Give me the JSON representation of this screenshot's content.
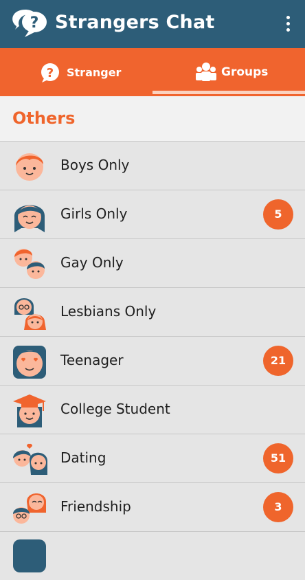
{
  "app": {
    "title": "Strangers Chat"
  },
  "tabs": [
    {
      "label": "Stranger",
      "icon": "question-bubble-icon"
    },
    {
      "label": "Groups",
      "icon": "group-icon"
    }
  ],
  "section": {
    "title": "Others"
  },
  "groups": [
    {
      "name": "Boys Only",
      "badge": ""
    },
    {
      "name": "Girls Only",
      "badge": "5"
    },
    {
      "name": "Gay Only",
      "badge": ""
    },
    {
      "name": "Lesbians Only",
      "badge": ""
    },
    {
      "name": "Teenager",
      "badge": "21"
    },
    {
      "name": "College Student",
      "badge": ""
    },
    {
      "name": "Dating",
      "badge": "51"
    },
    {
      "name": "Friendship",
      "badge": "3"
    }
  ],
  "colors": {
    "header": "#2d5d78",
    "accent": "#f0642e"
  }
}
